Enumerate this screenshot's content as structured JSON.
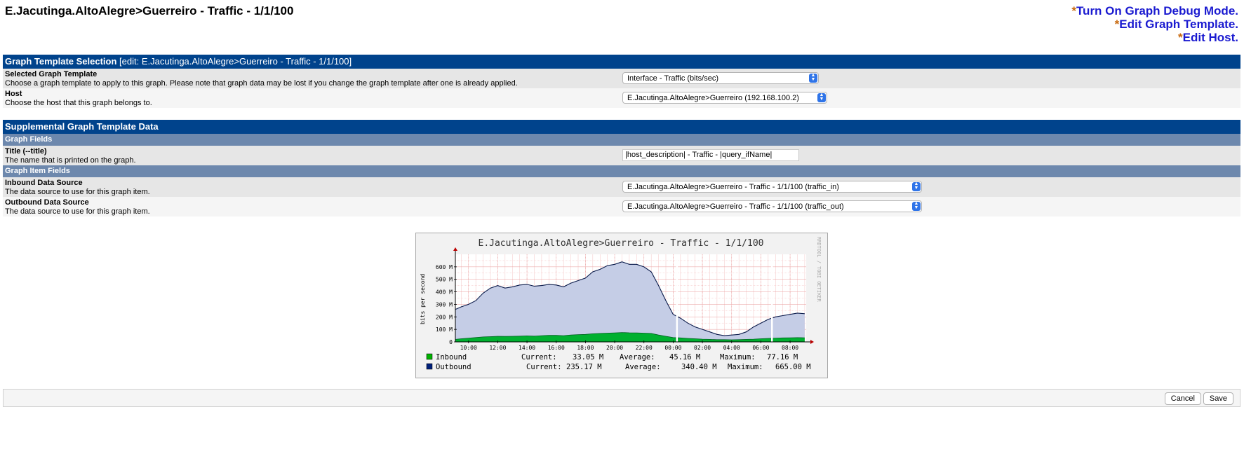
{
  "page": {
    "title": "E.Jacutinga.AltoAlegre>Guerreiro - Traffic - 1/1/100"
  },
  "links": [
    {
      "star": "*",
      "label": "Turn On Graph Debug Mode."
    },
    {
      "star": "*",
      "label": "Edit Graph Template."
    },
    {
      "star": "*",
      "label": "Edit Host."
    }
  ],
  "template_selection": {
    "header": "Graph Template Selection",
    "header_edit": "[edit: E.Jacutinga.AltoAlegre>Guerreiro - Traffic - 1/1/100]",
    "template_label": "Selected Graph Template",
    "template_desc": "Choose a graph template to apply to this graph. Please note that graph data may be lost if you change the graph template after one is already applied.",
    "template_value": "Interface - Traffic (bits/sec)",
    "host_label": "Host",
    "host_desc": "Choose the host that this graph belongs to.",
    "host_value": "E.Jacutinga.AltoAlegre>Guerreiro (192.168.100.2)"
  },
  "supplemental": {
    "header": "Supplemental Graph Template Data",
    "graph_fields": "Graph Fields",
    "title_label": "Title (--title)",
    "title_desc": "The name that is printed on the graph.",
    "title_value": "|host_description| - Traffic - |query_ifName|",
    "item_fields": "Graph Item Fields",
    "inbound_label": "Inbound Data Source",
    "inbound_desc": "The data source to use for this graph item.",
    "inbound_value": "E.Jacutinga.AltoAlegre>Guerreiro - Traffic - 1/1/100 (traffic_in)",
    "outbound_label": "Outbound Data Source",
    "outbound_desc": "The data source to use for this graph item.",
    "outbound_value": "E.Jacutinga.AltoAlegre>Guerreiro - Traffic - 1/1/100 (traffic_out)"
  },
  "graph": {
    "title": "E.Jacutinga.AltoAlegre>Guerreiro - Traffic - 1/1/100",
    "side_text": "RRDTOOL / TOBI OETIKER",
    "ylabel": "bits per second",
    "legend": [
      {
        "name": "Inbound",
        "color": "#00b000",
        "current_label": "Current:",
        "current": "33.05 M",
        "average_label": "Average:",
        "average": "45.16 M",
        "maximum_label": "Maximum:",
        "maximum": "77.16 M"
      },
      {
        "name": "Outbound",
        "color": "#00207a",
        "current_label": "Current:",
        "current": "235.17 M",
        "average_label": "Average:",
        "average": "340.40 M",
        "maximum_label": "Maximum:",
        "maximum": "665.00 M"
      }
    ]
  },
  "chart_data": {
    "type": "area",
    "title": "E.Jacutinga.AltoAlegre>Guerreiro - Traffic - 1/1/100",
    "ylabel": "bits per second",
    "xlabel": "",
    "ylim": [
      0,
      700
    ],
    "y_unit": "M",
    "y_ticks": [
      "0",
      "100 M",
      "200 M",
      "300 M",
      "400 M",
      "500 M",
      "600 M"
    ],
    "x_ticks": [
      "10:00",
      "12:00",
      "14:00",
      "16:00",
      "18:00",
      "20:00",
      "22:00",
      "00:00",
      "02:00",
      "04:00",
      "06:00",
      "08:00"
    ],
    "x_hours": [
      9.1,
      9.5,
      10,
      10.5,
      11,
      11.5,
      12,
      12.5,
      13,
      13.5,
      14,
      14.5,
      15,
      15.5,
      16,
      16.5,
      17,
      17.5,
      18,
      18.5,
      19,
      19.5,
      20,
      20.5,
      21,
      21.5,
      22,
      22.5,
      23,
      23.5,
      24,
      24.5,
      25,
      25.5,
      26,
      26.5,
      27,
      27.5,
      28,
      28.5,
      29,
      29.5,
      30,
      30.5,
      31,
      31.5,
      32,
      32.5,
      33
    ],
    "series": [
      {
        "name": "Outbound",
        "color": "#c5cde6",
        "values": [
          260,
          280,
          300,
          330,
          390,
          430,
          450,
          430,
          440,
          455,
          460,
          445,
          450,
          460,
          455,
          440,
          470,
          490,
          510,
          560,
          580,
          610,
          620,
          640,
          620,
          620,
          600,
          560,
          450,
          330,
          220,
          190,
          150,
          120,
          100,
          80,
          60,
          50,
          55,
          60,
          80,
          120,
          150,
          180,
          200,
          210,
          220,
          230,
          225
        ]
      },
      {
        "name": "Inbound",
        "color": "#00b030",
        "values": [
          20,
          25,
          30,
          35,
          40,
          42,
          45,
          44,
          45,
          46,
          48,
          46,
          50,
          52,
          52,
          50,
          55,
          58,
          60,
          65,
          68,
          70,
          72,
          75,
          73,
          72,
          70,
          68,
          55,
          45,
          35,
          32,
          28,
          25,
          22,
          20,
          18,
          18,
          17,
          18,
          20,
          22,
          25,
          28,
          30,
          32,
          33,
          34,
          33
        ]
      }
    ]
  },
  "actions": {
    "cancel": "Cancel",
    "save": "Save"
  }
}
